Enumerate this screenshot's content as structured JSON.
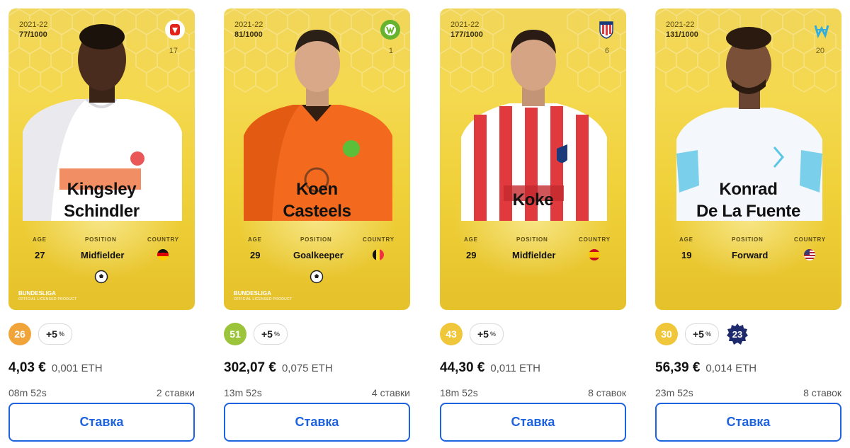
{
  "cards": [
    {
      "season": "2021-22",
      "serial": "77/1000",
      "club_icon": "fc-koln-crest-icon",
      "shirt_number": "17",
      "first_name": "Kingsley",
      "last_name": "Schindler",
      "age_label": "AGE",
      "position_label": "POSITION",
      "country_label": "COUNTRY",
      "age": "27",
      "position": "Midfielder",
      "country_flag": "germany-flag-icon",
      "league": "BUNDESLIGA",
      "league_sub": "OFFICIAL LICENSED PRODUCT",
      "jersey_color": "#ffffff",
      "score": "26",
      "score_color": "#f0a43a",
      "bonus": "+5",
      "bonus_unit": "%",
      "price_eur": "4,03 €",
      "price_eth": "0,001 ETH",
      "time_left": "08m 52s",
      "bids": "2 ставки",
      "button": "Ставка"
    },
    {
      "season": "2021-22",
      "serial": "81/1000",
      "club_icon": "vfl-wolfsburg-crest-icon",
      "shirt_number": "1",
      "first_name": "Koen",
      "last_name": "Casteels",
      "age_label": "AGE",
      "position_label": "POSITION",
      "country_label": "COUNTRY",
      "age": "29",
      "position": "Goalkeeper",
      "country_flag": "belgium-flag-icon",
      "league": "BUNDESLIGA",
      "league_sub": "OFFICIAL LICENSED PRODUCT",
      "jersey_color": "#f36a1e",
      "score": "51",
      "score_color": "#9cc43a",
      "bonus": "+5",
      "bonus_unit": "%",
      "price_eur": "302,07 €",
      "price_eth": "0,075 ETH",
      "time_left": "13m 52s",
      "bids": "4 ставки",
      "button": "Ставка"
    },
    {
      "season": "2021-22",
      "serial": "177/1000",
      "club_icon": "atletico-madrid-crest-icon",
      "shirt_number": "6",
      "first_name": "",
      "last_name": "Koke",
      "age_label": "AGE",
      "position_label": "POSITION",
      "country_label": "COUNTRY",
      "age": "29",
      "position": "Midfielder",
      "country_flag": "spain-flag-icon",
      "jersey_color": "#e03a3e",
      "score": "43",
      "score_color": "#f0c63a",
      "bonus": "+5",
      "bonus_unit": "%",
      "price_eur": "44,30 €",
      "price_eth": "0,011 ETH",
      "time_left": "18m 52s",
      "bids": "8 ставок",
      "button": "Ставка"
    },
    {
      "season": "2021-22",
      "serial": "131/1000",
      "club_icon": "olympique-marseille-crest-icon",
      "shirt_number": "20",
      "first_name": "Konrad",
      "last_name": "De La Fuente",
      "age_label": "AGE",
      "position_label": "POSITION",
      "country_label": "COUNTRY",
      "age": "19",
      "position": "Forward",
      "country_flag": "usa-flag-icon",
      "jersey_color": "#f4f7fb",
      "score": "30",
      "score_color": "#f0c63a",
      "bonus": "+5",
      "bonus_unit": "%",
      "level": "23",
      "price_eur": "56,39 €",
      "price_eth": "0,014 ETH",
      "time_left": "23m 52s",
      "bids": "8 ставок",
      "button": "Ставка"
    }
  ]
}
